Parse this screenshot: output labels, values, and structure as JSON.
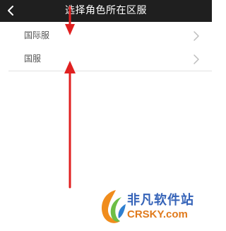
{
  "header": {
    "title": "选择角色所在区服",
    "back_icon": "chevron-left-icon"
  },
  "servers": [
    {
      "label": "国际服",
      "icon": "chevron-right-icon"
    },
    {
      "label": "国服",
      "icon": "chevron-right-icon"
    }
  ],
  "annotation": {
    "arrow_color": "#e02020",
    "arrows": [
      "arrow-down-to-国际服",
      "arrow-up-to-国服"
    ]
  },
  "watermark": {
    "name_cn": "非凡软件站",
    "name_en": "CRSKY.com"
  }
}
